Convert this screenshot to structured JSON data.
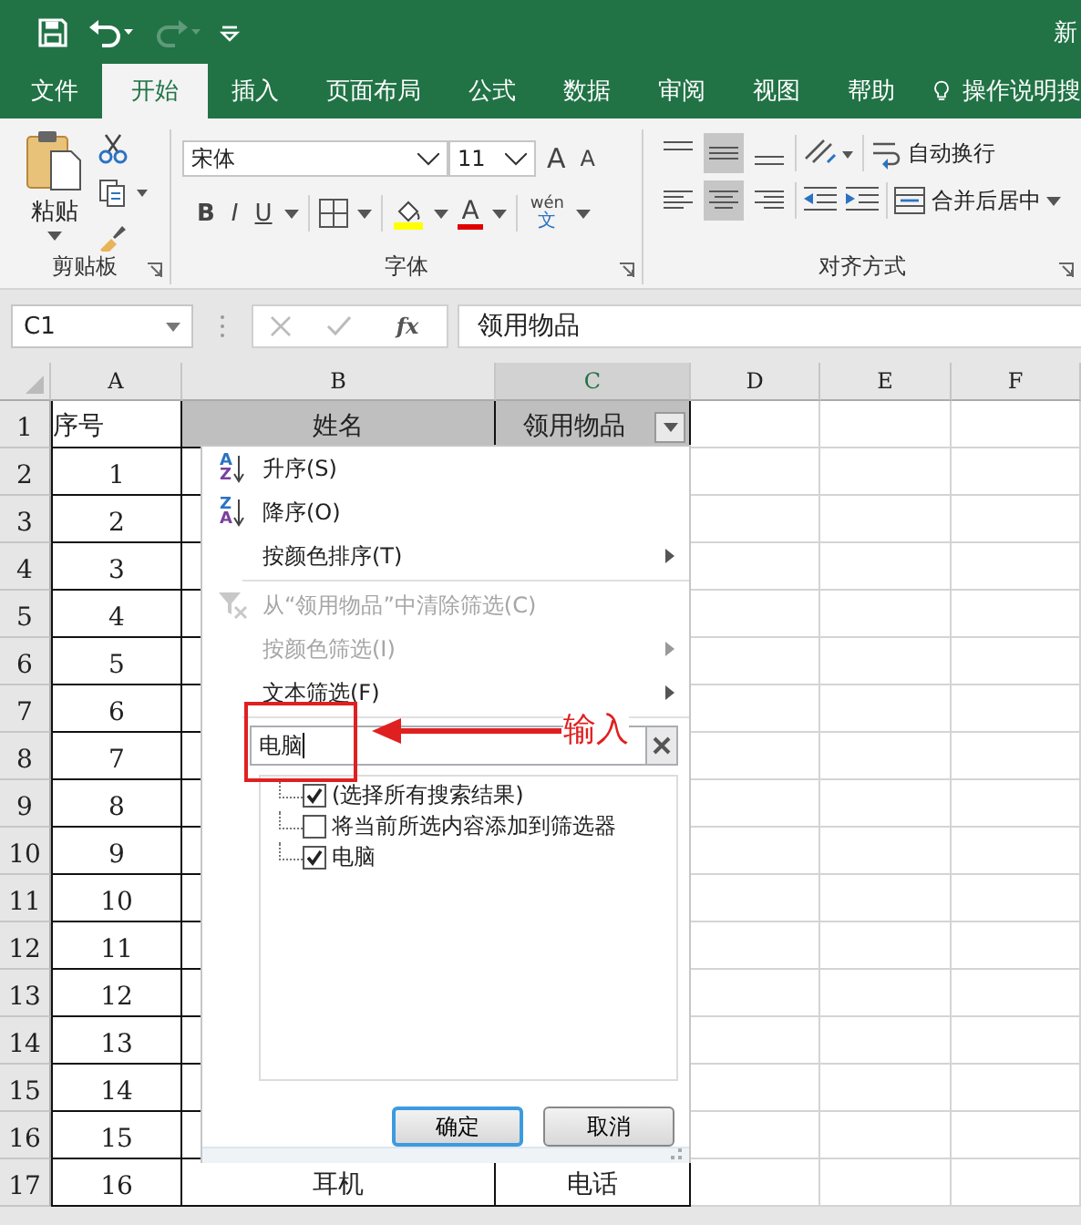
{
  "title": "新",
  "ribbon_tabs": [
    {
      "label": "文件",
      "selected": false
    },
    {
      "label": "开始",
      "selected": true
    },
    {
      "label": "插入",
      "selected": false
    },
    {
      "label": "页面布局",
      "selected": false
    },
    {
      "label": "公式",
      "selected": false
    },
    {
      "label": "数据",
      "selected": false
    },
    {
      "label": "审阅",
      "selected": false
    },
    {
      "label": "视图",
      "selected": false
    },
    {
      "label": "帮助",
      "selected": false
    }
  ],
  "tell_me": "操作说明搜",
  "clipboard": {
    "paste": "粘贴",
    "group": "剪贴板"
  },
  "font": {
    "name": "宋体",
    "size": "11",
    "grow": "A",
    "shrink": "A",
    "bold": "B",
    "italic": "I",
    "underline": "U",
    "color_letter": "A",
    "phonetic_top": "wén",
    "phonetic_bottom": "文",
    "group": "字体"
  },
  "alignment": {
    "wrap": "自动换行",
    "merge": "合并后居中",
    "group": "对齐方式"
  },
  "name_box": "C1",
  "fx": "fx",
  "formula": "领用物品",
  "columns": [
    {
      "label": "A",
      "selected": false
    },
    {
      "label": "B",
      "selected": false
    },
    {
      "label": "C",
      "selected": true
    },
    {
      "label": "D",
      "selected": false
    },
    {
      "label": "E",
      "selected": false
    },
    {
      "label": "F",
      "selected": false
    }
  ],
  "rows": [
    {
      "number": "1",
      "cells": [
        {
          "text": "序号",
          "shaded": false
        },
        {
          "text": "姓名",
          "shaded": true
        },
        {
          "text": "领用物品",
          "shaded": true
        }
      ]
    },
    {
      "number": "2",
      "cells": [
        {
          "text": "1",
          "shaded": false
        }
      ]
    },
    {
      "number": "3",
      "cells": [
        {
          "text": "2",
          "shaded": false
        }
      ]
    },
    {
      "number": "4",
      "cells": [
        {
          "text": "3",
          "shaded": false
        }
      ]
    },
    {
      "number": "5",
      "cells": [
        {
          "text": "4",
          "shaded": false
        }
      ]
    },
    {
      "number": "6",
      "cells": [
        {
          "text": "5",
          "shaded": false
        }
      ]
    },
    {
      "number": "7",
      "cells": [
        {
          "text": "6",
          "shaded": false
        }
      ]
    },
    {
      "number": "8",
      "cells": [
        {
          "text": "7",
          "shaded": false
        }
      ]
    },
    {
      "number": "9",
      "cells": [
        {
          "text": "8",
          "shaded": false
        }
      ]
    },
    {
      "number": "10",
      "cells": [
        {
          "text": "9",
          "shaded": false
        }
      ]
    },
    {
      "number": "11",
      "cells": [
        {
          "text": "10",
          "shaded": false
        }
      ]
    },
    {
      "number": "12",
      "cells": [
        {
          "text": "11",
          "shaded": false
        }
      ]
    },
    {
      "number": "13",
      "cells": [
        {
          "text": "12",
          "shaded": false
        }
      ]
    },
    {
      "number": "14",
      "cells": [
        {
          "text": "13",
          "shaded": false
        }
      ]
    },
    {
      "number": "15",
      "cells": [
        {
          "text": "14",
          "shaded": false
        }
      ]
    },
    {
      "number": "16",
      "cells": [
        {
          "text": "15",
          "shaded": false
        }
      ]
    },
    {
      "number": "17",
      "cells": [
        {
          "text": "16",
          "shaded": false
        },
        {
          "text": "耳机",
          "shaded": false
        },
        {
          "text": "电话",
          "shaded": false
        }
      ]
    }
  ],
  "filter_menu": {
    "items": [
      {
        "kind": "sort",
        "icon_letters": [
          "A",
          "Z"
        ],
        "label": "升序(S)",
        "disabled": false,
        "submenu": false
      },
      {
        "kind": "sort",
        "icon_letters": [
          "Z",
          "A"
        ],
        "label": "降序(O)",
        "disabled": false,
        "submenu": false
      },
      {
        "kind": "command",
        "label": "按颜色排序(T)",
        "disabled": false,
        "submenu": true
      },
      {
        "kind": "separator"
      },
      {
        "kind": "clear",
        "label": "从“领用物品”中清除筛选(C)",
        "disabled": true,
        "submenu": false
      },
      {
        "kind": "command",
        "label": "按颜色筛选(I)",
        "disabled": true,
        "submenu": true
      },
      {
        "kind": "command",
        "label": "文本筛选(F)",
        "disabled": false,
        "submenu": true
      },
      {
        "kind": "separator"
      }
    ],
    "search": {
      "value": "电脑"
    },
    "list": [
      {
        "label": "(选择所有搜索结果)",
        "checked": true
      },
      {
        "label": "将当前所选内容添加到筛选器",
        "checked": false
      },
      {
        "label": "电脑",
        "checked": true
      }
    ],
    "buttons": [
      {
        "label": "确定",
        "default": true
      },
      {
        "label": "取消",
        "default": false
      }
    ]
  },
  "annotation": {
    "label": "输入"
  }
}
